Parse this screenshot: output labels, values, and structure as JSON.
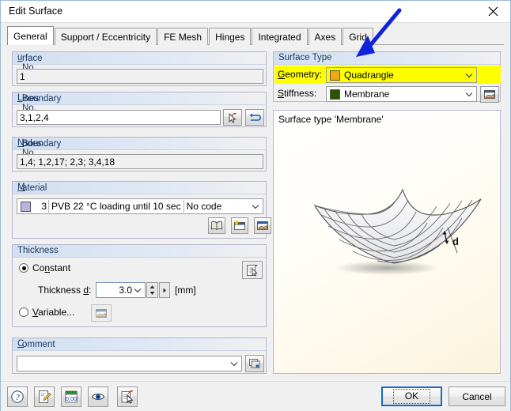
{
  "window": {
    "title": "Edit Surface",
    "close_icon": "close-icon"
  },
  "tabs": [
    {
      "label": "General",
      "active": true
    },
    {
      "label": "Support / Eccentricity",
      "active": false
    },
    {
      "label": "FE Mesh",
      "active": false
    },
    {
      "label": "Hinges",
      "active": false
    },
    {
      "label": "Integrated",
      "active": false
    },
    {
      "label": "Axes",
      "active": false
    },
    {
      "label": "Grid",
      "active": false
    }
  ],
  "surface_no": {
    "caption_pre": "S",
    "caption_accel": "u",
    "caption_post": "rface No.",
    "caption_full": "Surface No.",
    "value": "1"
  },
  "boundary_lines": {
    "caption_pre": "Boundary ",
    "caption_accel": "L",
    "caption_post": "ines No.",
    "caption_full": "Boundary Lines No.",
    "value": "3,1,2,4",
    "pick_button_icon": "pick-cursor-icon",
    "loop_button_icon": "line-loop-icon"
  },
  "boundary_nodes": {
    "caption_pre": "Boundary ",
    "caption_accel": "N",
    "caption_post": "odes No.",
    "caption_full": "Boundary Nodes No.",
    "value": "1,4; 1,2,17; 2,3; 3,4,18"
  },
  "material": {
    "caption_pre": "",
    "caption_accel": "M",
    "caption_post": "aterial",
    "caption_full": "Material",
    "color": "#b9b3dd",
    "number": "3",
    "name": "PVB 22 °C loading until 10 sec",
    "code": "No code",
    "library_button_icon": "material-library-icon",
    "new_button_icon": "new-material-icon",
    "edit_button_icon": "edit-material-icon"
  },
  "thickness": {
    "caption_full": "Thickness",
    "constant": {
      "pre": "Co",
      "accel": "n",
      "post": "stant",
      "full": "Constant",
      "selected": true
    },
    "thickness_label_pre": "Thickness ",
    "thickness_label_accel": "d",
    "thickness_label_post": ":",
    "thickness_label_full": "Thickness d:",
    "value": "3.0",
    "unit": "[mm]",
    "variable": {
      "pre": "",
      "accel": "V",
      "post": "ariable...",
      "full": "Variable...",
      "selected": false
    },
    "variable_button_icon": "edit-variable-icon",
    "table_button_icon": "thickness-table-icon"
  },
  "comment": {
    "caption_pre": "",
    "caption_accel": "C",
    "caption_post": "omment",
    "caption_full": "Comment",
    "value": "",
    "button_icon": "comment-library-icon"
  },
  "surface_type": {
    "caption_full": "Surface Type",
    "geometry": {
      "label_pre": "",
      "label_accel": "G",
      "label_post": "eometry:",
      "label_full": "Geometry:",
      "value": "Quadrangle",
      "swatch_color": "#f0a80a",
      "highlight_color": "#ffff00",
      "highlighted": true
    },
    "stiffness": {
      "label_pre": "",
      "label_accel": "S",
      "label_post": "tiffness:",
      "label_full": "Stiffness:",
      "value": "Membrane",
      "swatch_color": "#2d5103",
      "edit_button_icon": "edit-stiffness-icon"
    }
  },
  "illustration": {
    "label": "Surface type 'Membrane'",
    "thickness_annotation": "d"
  },
  "annotation": {
    "arrow_color": "#1122dd",
    "icon": "pointer-arrow-annotation"
  },
  "bottom_toolbar": [
    {
      "name": "help-button",
      "icon": "help-question-icon"
    },
    {
      "name": "edit-button",
      "icon": "pencil-edit-icon"
    },
    {
      "name": "units-button",
      "icon": "units-ruler-icon"
    },
    {
      "name": "view-button",
      "icon": "eye-view-icon"
    },
    {
      "name": "info-button",
      "icon": "document-cursor-icon"
    }
  ],
  "buttons": {
    "ok": "OK",
    "cancel": "Cancel"
  }
}
